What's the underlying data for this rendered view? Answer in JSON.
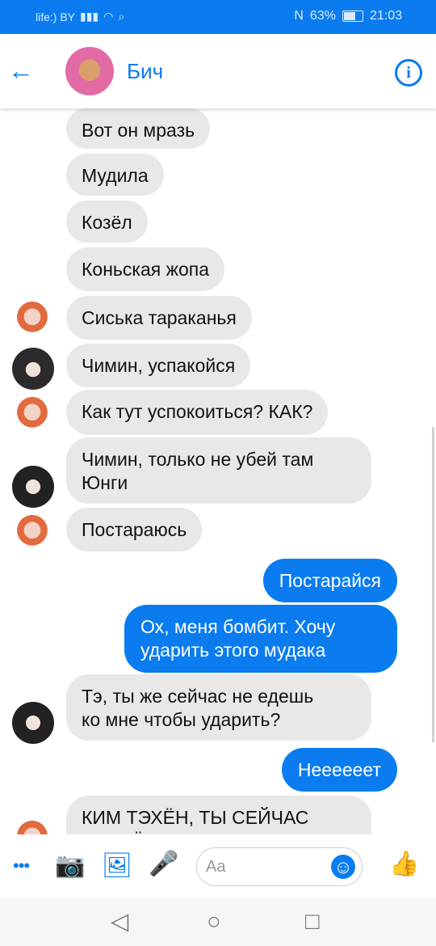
{
  "status": {
    "carrier": "life:) BY",
    "signal": "▮▮▮",
    "wifi": "◠",
    "search": "⌕",
    "nfc": "N",
    "battery": "63%",
    "time": "21:03"
  },
  "header": {
    "back": "←",
    "title": "Бич",
    "info": "i"
  },
  "messages": [
    {
      "text": "Вот он мразь"
    },
    {
      "text": "Мудила"
    },
    {
      "text": "Козёл"
    },
    {
      "text": "Коньская жопа"
    },
    {
      "text": "Сиська тараканья"
    },
    {
      "text": "Чимин, успакойся"
    },
    {
      "text": "Как тут успокоиться? КАК?"
    },
    {
      "text": "Чимин, только не убей там\nЮнги"
    },
    {
      "text": "Постараюсь"
    },
    {
      "text": "Постарайся"
    },
    {
      "text": "Ох, меня бомбит. Хочу\nударить этого мудака"
    },
    {
      "text": "Тэ, ты же сейчас не едешь\nко мне чтобы ударить?"
    },
    {
      "text": "Неееееет"
    },
    {
      "text": "КИМ ТЭХЁН, ТЫ СЕЙЧАС\nСЕРЬЁЗНО?"
    }
  ],
  "composer": {
    "more": "•••",
    "camera": "📷",
    "image": "🖼",
    "mic": "🎤",
    "placeholder": "Aa",
    "emoji": "☺",
    "like": "👍"
  },
  "nav": {
    "back": "◁",
    "home": "○",
    "recent": "□"
  },
  "colors": {
    "accent": "#0a7cf0",
    "incoming": "#e8e8e8"
  }
}
